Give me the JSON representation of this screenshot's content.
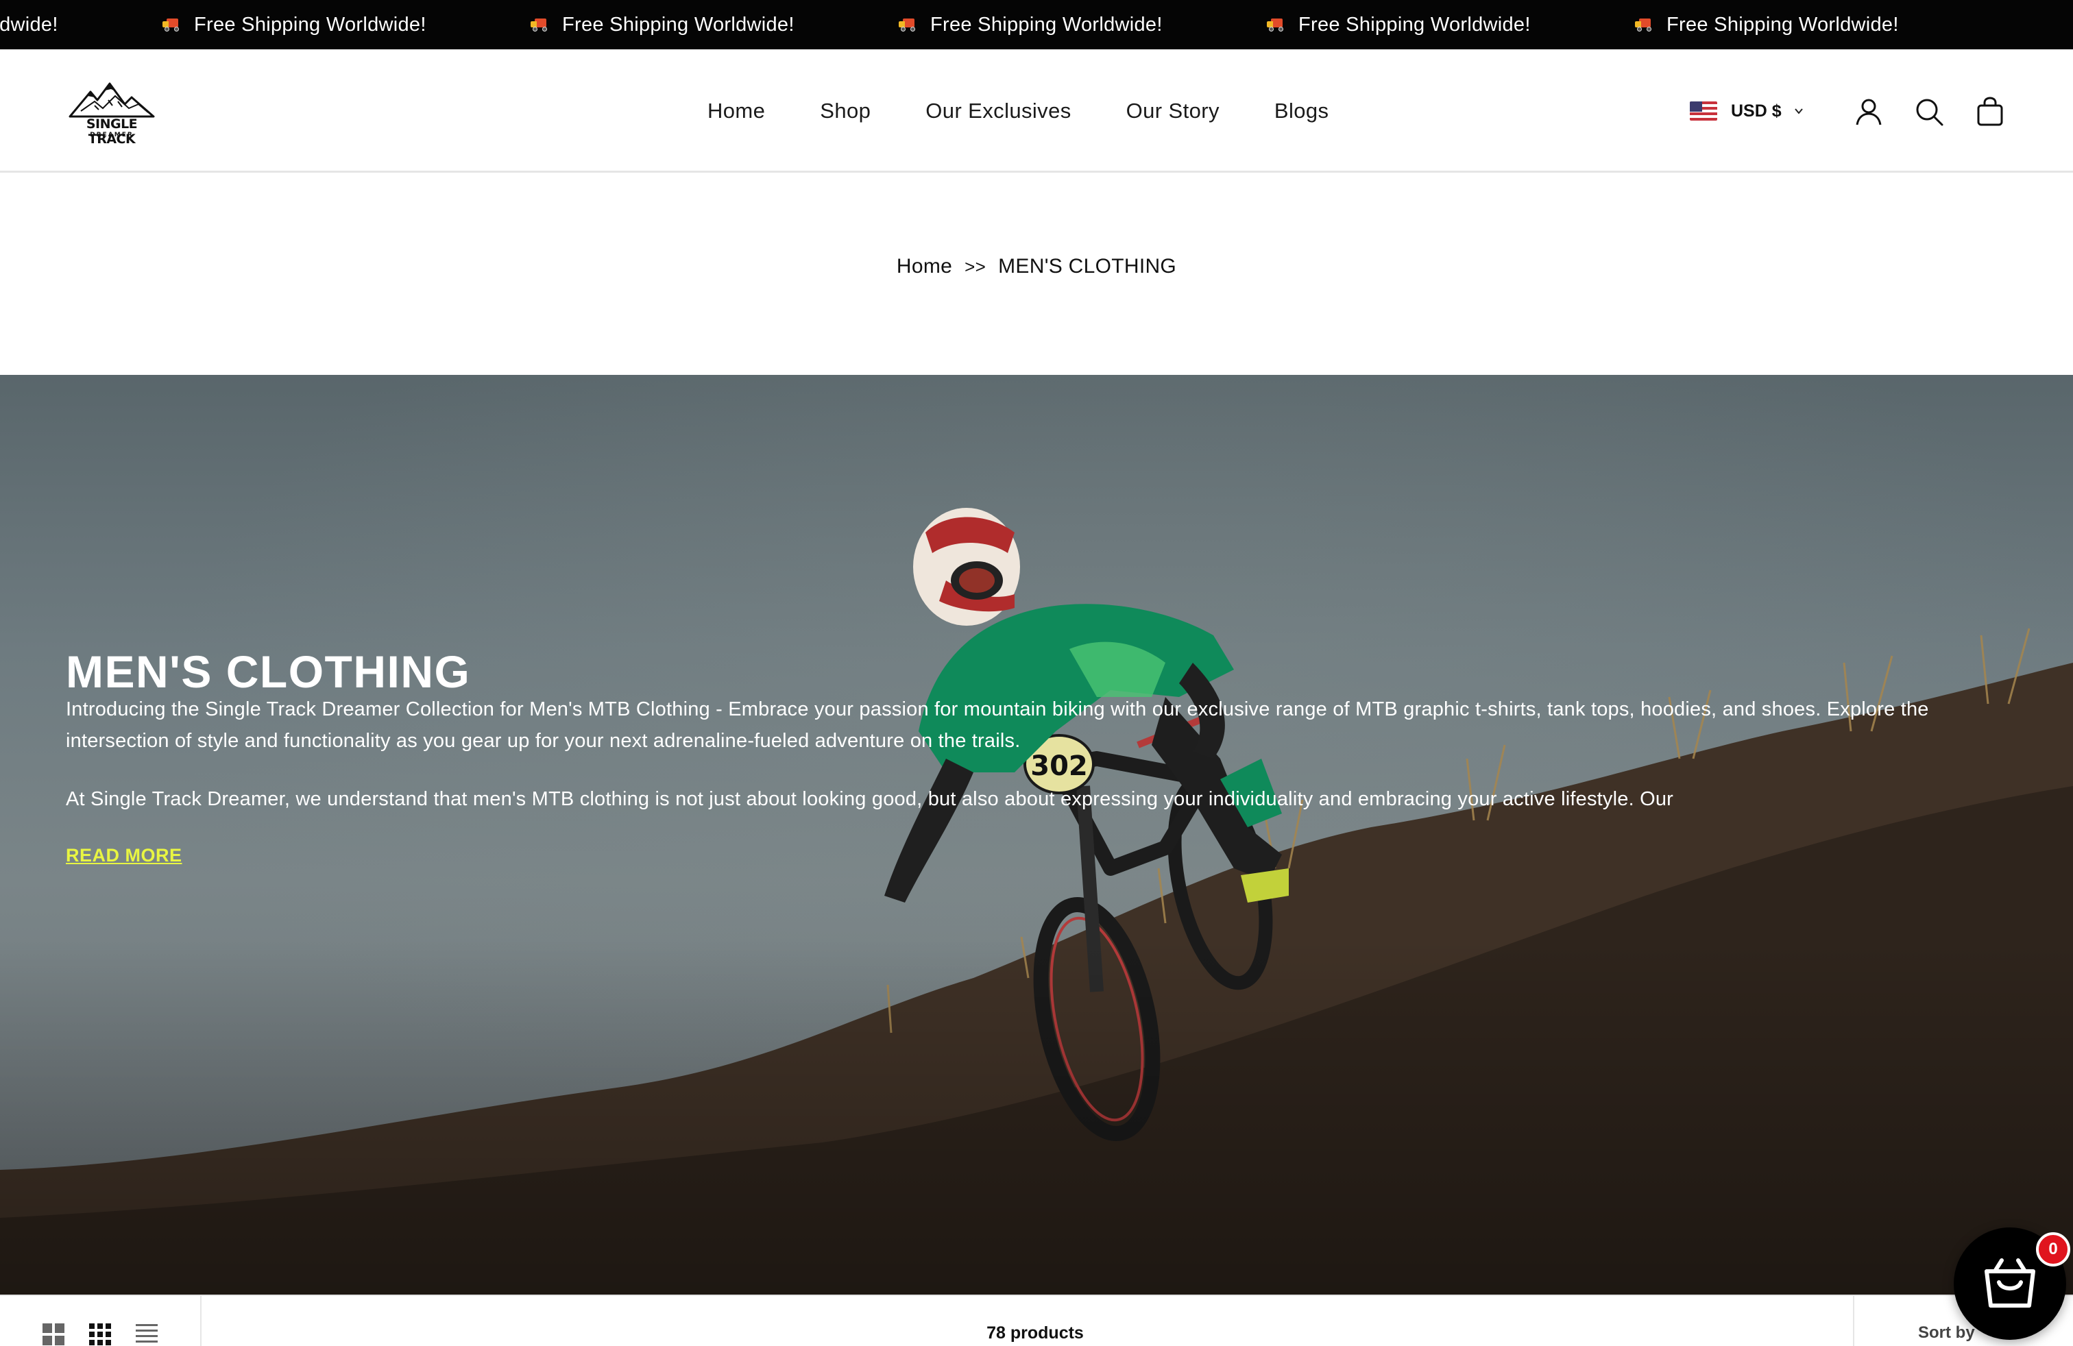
{
  "announcement": {
    "message": "Free Shipping Worldwide!",
    "icon": "delivery-truck-icon",
    "repeats": 6
  },
  "header": {
    "logo": {
      "line1": "SINGLE TRACK",
      "line2": "DREAMER"
    },
    "nav": [
      "Home",
      "Shop",
      "Our Exclusives",
      "Our Story",
      "Blogs"
    ],
    "currency": {
      "label": "USD $",
      "flag": "us-flag-icon"
    },
    "icons": [
      "account-icon",
      "search-icon",
      "shopping-bag-icon"
    ]
  },
  "breadcrumb": {
    "home": "Home",
    "separator": ">>",
    "current": "MEN'S CLOTHING"
  },
  "hero": {
    "title": "MEN'S CLOTHING",
    "paragraph1": "Introducing the Single Track Dreamer Collection for Men's MTB Clothing - Embrace your passion for mountain biking with our exclusive range of MTB graphic t-shirts, tank tops, hoodies, and shoes. Explore the intersection of style and functionality as you gear up for your next adrenaline-fueled adventure on the trails.",
    "paragraph2": "At Single Track Dreamer, we understand that men's MTB clothing is not just about looking good, but also about expressing your individuality and embracing your active lifestyle. Our",
    "read_more": "READ MORE",
    "plate_number": "302"
  },
  "toolbar": {
    "view_icons": [
      "grid-2-icon",
      "grid-3-icon",
      "list-icon"
    ],
    "products_count": "78 products",
    "sort_label": "Sort by"
  },
  "floating_cart": {
    "count": "0",
    "icon": "cart-basket-icon"
  },
  "colors": {
    "announcement_bg": "#050505",
    "read_more": "#e8f542",
    "badge": "#e0141e",
    "text": "#111111"
  }
}
